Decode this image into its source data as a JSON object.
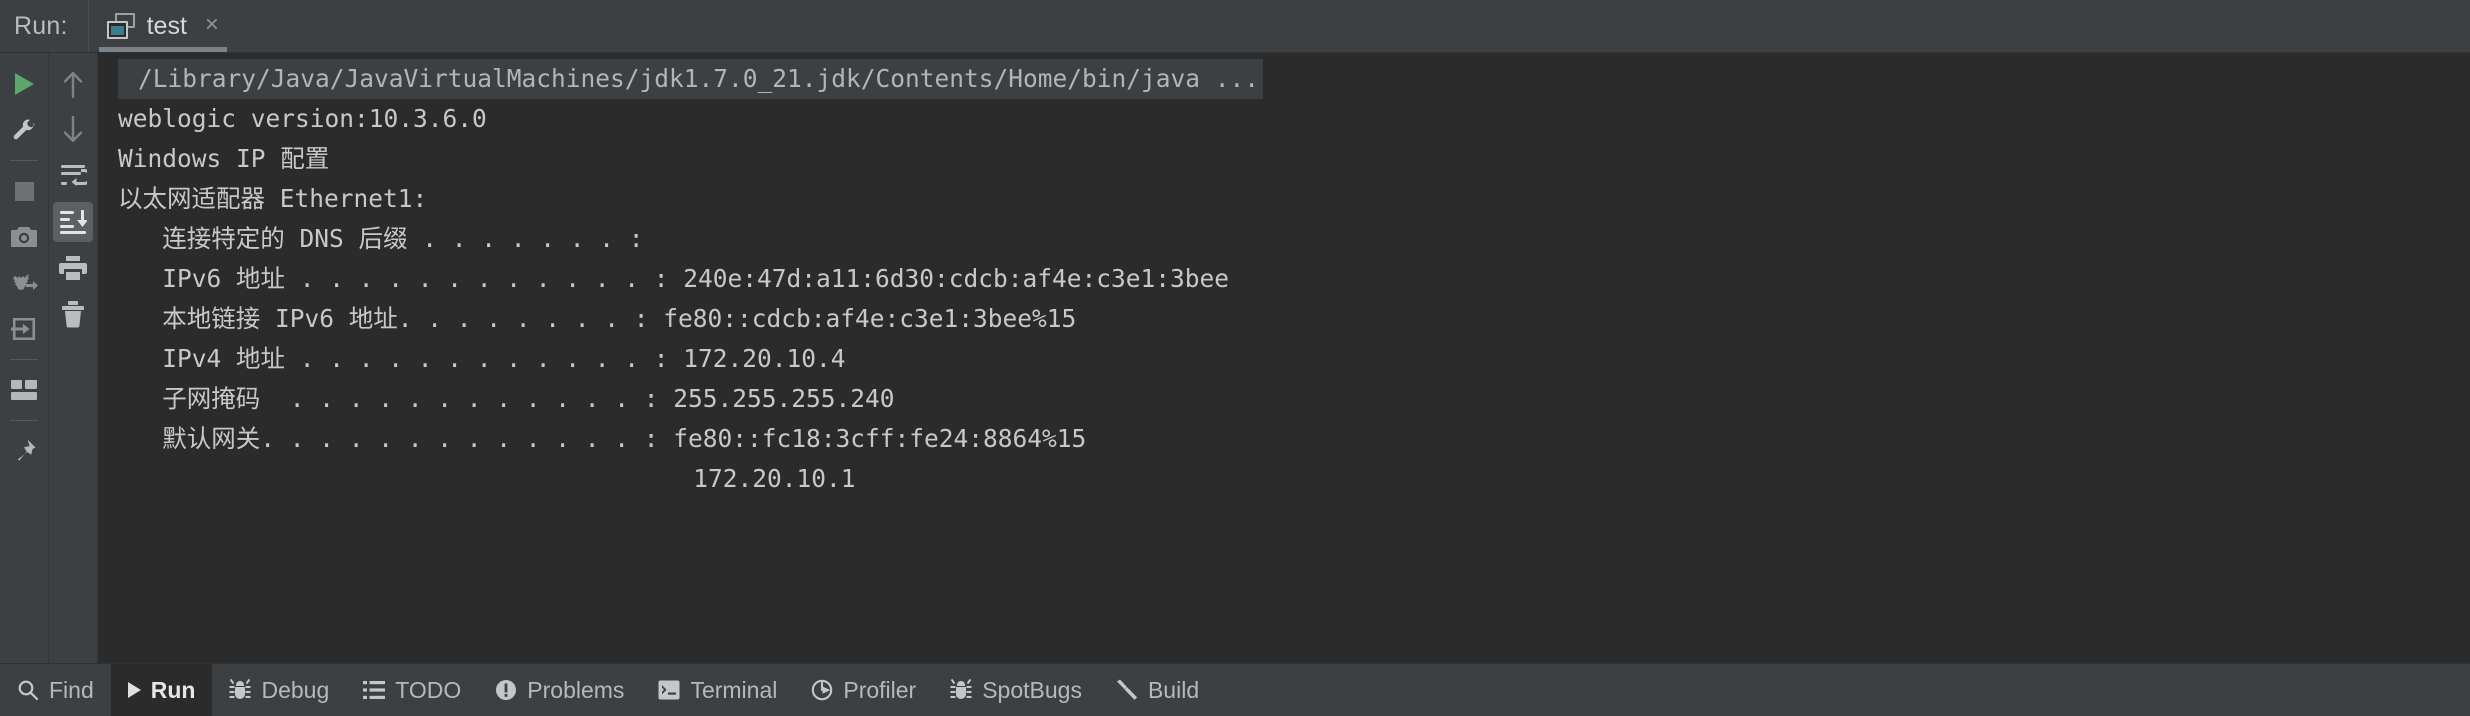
{
  "header": {
    "run_label": "Run:",
    "tab": {
      "label": "test",
      "icon": "window-icon",
      "close_glyph": "×"
    }
  },
  "toolbar_left": {
    "items": [
      {
        "name": "rerun-button",
        "icon": "play-icon",
        "type": "icon"
      },
      {
        "name": "edit-configuration-button",
        "icon": "wrench-icon",
        "type": "icon"
      },
      {
        "name": "separator-1",
        "icon": "separator",
        "type": "separator"
      },
      {
        "name": "stop-button",
        "icon": "stop-icon",
        "type": "icon"
      },
      {
        "name": "screenshot-button",
        "icon": "camera-icon",
        "type": "icon"
      },
      {
        "name": "restart-debug-button",
        "icon": "bug-arrow-icon",
        "type": "icon"
      },
      {
        "name": "attach-process-button",
        "icon": "export-arrow-icon",
        "type": "icon"
      },
      {
        "name": "separator-2",
        "icon": "separator",
        "type": "separator"
      },
      {
        "name": "layout-settings-button",
        "icon": "layout-icon",
        "type": "icon"
      },
      {
        "name": "separator-3",
        "icon": "separator",
        "type": "separator"
      },
      {
        "name": "pin-tab-button",
        "icon": "pin-icon",
        "type": "icon"
      }
    ]
  },
  "toolbar_console": {
    "items": [
      {
        "name": "up-the-stack-trace-button",
        "icon": "arrow-up-icon",
        "selected": false
      },
      {
        "name": "down-the-stack-trace-button",
        "icon": "arrow-down-icon",
        "selected": false
      },
      {
        "name": "soft-wrap-button",
        "icon": "soft-wrap-icon",
        "selected": false
      },
      {
        "name": "scroll-to-end-button",
        "icon": "scroll-to-end-icon",
        "selected": true
      },
      {
        "name": "print-button",
        "icon": "printer-icon",
        "selected": false
      },
      {
        "name": "clear-all-button",
        "icon": "trash-icon",
        "selected": false
      }
    ]
  },
  "console": {
    "lines": [
      {
        "text": "/Library/Java/JavaVirtualMachines/jdk1.7.0_21.jdk/Contents/Home/bin/java ...",
        "style": "command"
      },
      {
        "text": "weblogic version:10.3.6.0",
        "style": "normal"
      },
      {
        "text": "",
        "style": "normal"
      },
      {
        "text": "Windows IP 配置",
        "style": "normal"
      },
      {
        "text": "",
        "style": "normal"
      },
      {
        "text": "",
        "style": "normal"
      },
      {
        "text": "以太网适配器 Ethernet1:",
        "style": "normal"
      },
      {
        "text": "",
        "style": "normal"
      },
      {
        "text": "   连接特定的 DNS 后缀 . . . . . . . :",
        "style": "normal"
      },
      {
        "text": "   IPv6 地址 . . . . . . . . . . . . : 240e:47d:a11:6d30:cdcb:af4e:c3e1:3bee",
        "style": "normal"
      },
      {
        "text": "   本地链接 IPv6 地址. . . . . . . . : fe80::cdcb:af4e:c3e1:3bee%15",
        "style": "normal"
      },
      {
        "text": "   IPv4 地址 . . . . . . . . . . . . : 172.20.10.4",
        "style": "normal"
      },
      {
        "text": "   子网掩码  . . . . . . . . . . . . : 255.255.255.240",
        "style": "normal"
      },
      {
        "text": "   默认网关. . . . . . . . . . . . . : fe80::fc18:3cff:fe24:8864%15",
        "style": "normal"
      },
      {
        "text": "                                       172.20.10.1",
        "style": "normal"
      }
    ]
  },
  "statusbar": {
    "items": [
      {
        "label": "Find",
        "icon": "search-icon",
        "active": false
      },
      {
        "label": "Run",
        "icon": "play-icon",
        "active": true
      },
      {
        "label": "Debug",
        "icon": "bug-icon",
        "active": false
      },
      {
        "label": "TODO",
        "icon": "list-icon",
        "active": false
      },
      {
        "label": "Problems",
        "icon": "exclamation-circle-icon",
        "active": false
      },
      {
        "label": "Terminal",
        "icon": "terminal-icon",
        "active": false
      },
      {
        "label": "Profiler",
        "icon": "gauge-icon",
        "active": false
      },
      {
        "label": "SpotBugs",
        "icon": "bug-icon",
        "active": false
      },
      {
        "label": "Build",
        "icon": "hammer-icon",
        "active": false
      }
    ]
  },
  "colors": {
    "panel": "#3c4043",
    "console_bg": "#2b2b2b",
    "text": "#c8c8c8",
    "accent_green": "#59a869",
    "tab_icon_blue": "#3d7c8c",
    "selected_toolbtn": "#5b6065"
  }
}
